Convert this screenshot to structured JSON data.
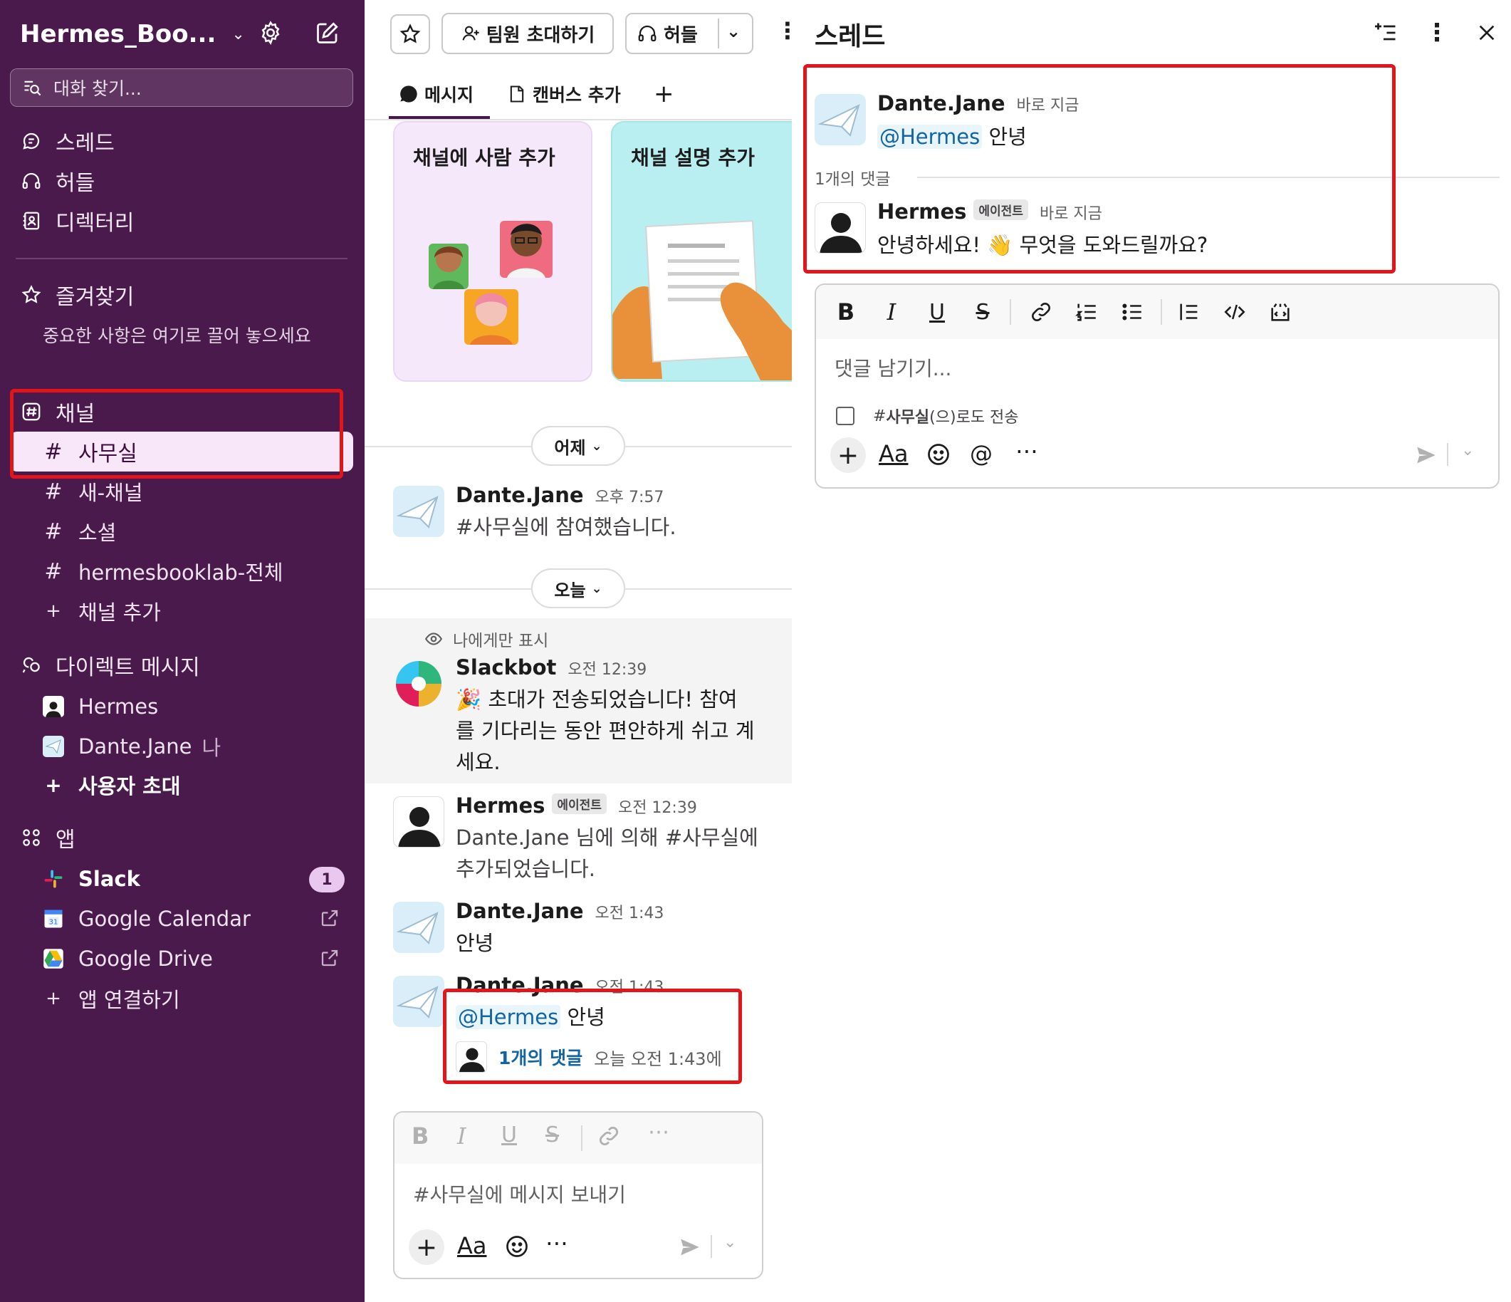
{
  "workspace": {
    "name": "Hermes_Boo..."
  },
  "sidebar": {
    "search_placeholder": "대화 찾기...",
    "nav": [
      {
        "label": "스레드",
        "icon": "threads-icon"
      },
      {
        "label": "허들",
        "icon": "headphones-icon"
      },
      {
        "label": "디렉터리",
        "icon": "directory-icon"
      }
    ],
    "favorites": {
      "label": "즐겨찾기",
      "hint": "중요한 사항은 여기로 끌어 놓으세요"
    },
    "channels_label": "채널",
    "channels": [
      {
        "name": "사무실",
        "active": true
      },
      {
        "name": "새-채널"
      },
      {
        "name": "소셜"
      },
      {
        "name": "hermesbooklab-전체"
      }
    ],
    "add_channel": "채널 추가",
    "dm_label": "다이렉트 메시지",
    "dms": [
      {
        "name": "Hermes"
      },
      {
        "name": "Dante.Jane",
        "suffix": "나"
      }
    ],
    "invite_users": "사용자 초대",
    "apps_label": "앱",
    "apps": [
      {
        "name": "Slack",
        "badge": "1"
      },
      {
        "name": "Google Calendar"
      },
      {
        "name": "Google Drive"
      }
    ],
    "connect_app": "앱 연결하기"
  },
  "channel": {
    "invite_button": "팀원 초대하기",
    "huddle_button": "허들",
    "tabs": [
      {
        "label": "메시지",
        "active": true
      },
      {
        "label": "캔버스 추가"
      }
    ],
    "cards": [
      {
        "title": "채널에 사람 추가",
        "bg": "#f5e8fb"
      },
      {
        "title": "채널 설명 추가",
        "bg": "#b9eff0"
      }
    ],
    "day_yesterday": "어제",
    "day_today": "오늘",
    "only_visible_to_you": "나에게만 표시",
    "messages": [
      {
        "author": "Dante.Jane",
        "time": "오후 7:57",
        "text": "#사무실에 참여했습니다."
      },
      {
        "author": "Slackbot",
        "time": "오전 12:39",
        "text_lines": [
          "🎉 초대가 전송되었습니다! 참여",
          "를 기다리는 동안 편안하게 쉬고 계",
          "세요."
        ]
      },
      {
        "author": "Hermes",
        "tag": "에이전트",
        "time": "오전 12:39",
        "text_lines": [
          "Dante.Jane 님에 의해 #사무실에",
          "추가되었습니다."
        ]
      },
      {
        "author": "Dante.Jane",
        "time": "오전 1:43",
        "text": "안녕"
      },
      {
        "author": "Dante.Jane",
        "time": "오전 1:43",
        "mention": "@Hermes",
        "text": "안녕",
        "replies": "1개의 댓글",
        "replies_time": "오늘 오전 1:43에"
      }
    ],
    "composer_placeholder": "#사무실에 메시지 보내기"
  },
  "thread": {
    "title": "스레드",
    "parent": {
      "author": "Dante.Jane",
      "time": "바로 지금",
      "mention": "@Hermes",
      "text": "안녕"
    },
    "reply_count": "1개의 댓글",
    "reply": {
      "author": "Hermes",
      "tag": "에이전트",
      "time": "바로 지금",
      "text": "안녕하세요! 👋 무엇을 도와드릴까요?"
    },
    "composer_placeholder": "댓글 남기기...",
    "also_send_prefix": "# ",
    "also_send_channel": "사무실",
    "also_send_suffix": "(으)로도 전송"
  },
  "colors": {
    "sidebar_bg": "#4a1a4c",
    "highlight": "#e3151a",
    "link": "#1264a3"
  }
}
